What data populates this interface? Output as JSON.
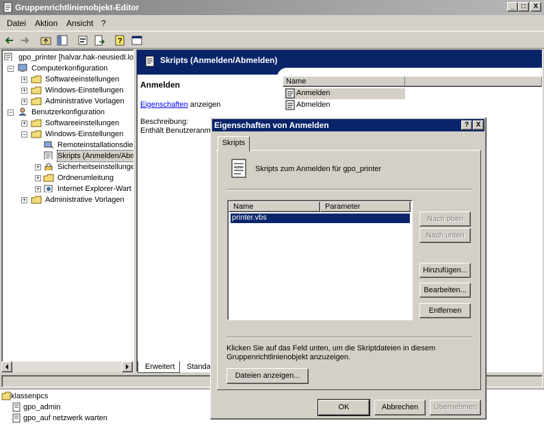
{
  "window": {
    "title": "Gruppenrichtlinienobjekt-Editor",
    "min_label": "_",
    "max_label": "□",
    "close_label": "X"
  },
  "menu": [
    "Datei",
    "Aktion",
    "Ansicht",
    "?"
  ],
  "tree": {
    "items": [
      {
        "label": "gpo_printer [halvar.hak-neusiedl.lo"
      },
      {
        "label": "Computerkonfiguration"
      },
      {
        "label": "Softwareeinstellungen"
      },
      {
        "label": "Windows-Einstellungen"
      },
      {
        "label": "Administrative Vorlagen"
      },
      {
        "label": "Benutzerkonfiguration"
      },
      {
        "label": "Softwareeinstellungen"
      },
      {
        "label": "Windows-Einstellungen"
      },
      {
        "label": "Remoteinstallationsdier"
      },
      {
        "label": "Skripts (Anmelden/Abm"
      },
      {
        "label": "Sicherheitseinstellunge"
      },
      {
        "label": "Ordnerumleitung"
      },
      {
        "label": "Internet Explorer-Wart"
      },
      {
        "label": "Administrative Vorlagen"
      }
    ],
    "expand_plus": "+",
    "expand_minus": "−"
  },
  "rightpane": {
    "header": "Skripts (Anmelden/Abmelden)",
    "section_title": "Anmelden",
    "link_text": "Eigenschaften",
    "link_suffix": " anzeigen",
    "desc_label": "Beschreibung:",
    "desc_text": "Enthält Benutzeranme",
    "list_header": "Name",
    "list_items": [
      "Anmelden",
      "Abmelden"
    ]
  },
  "tabs": {
    "extended": "Erweitert",
    "standard": "Standa"
  },
  "lower": {
    "items": [
      "klassenpcs",
      "gpo_admin",
      "gpo_auf netzwerk warten"
    ]
  },
  "dialog": {
    "title": "Eigenschaften von Anmelden",
    "help_label": "?",
    "close_label": "X",
    "tab_label": "Skripts",
    "heading": "Skripts zum Anmelden für gpo_printer",
    "col_name": "Name",
    "col_param": "Parameter",
    "scripts": [
      {
        "name": "printer.vbs",
        "param": ""
      }
    ],
    "btn_up": "Nach oben",
    "btn_down": "Nach unten",
    "btn_add": "Hinzufügen...",
    "btn_edit": "Bearbeiten...",
    "btn_remove": "Entfernen",
    "info_text": "Klicken Sie auf das Feld unten, um die Skriptdateien in diesem Gruppenrichtlinienobjekt anzuzeigen.",
    "btn_show": "Dateien anzeigen...",
    "btn_ok": "OK",
    "btn_cancel": "Abbrechen",
    "btn_apply": "Übernehmen"
  }
}
